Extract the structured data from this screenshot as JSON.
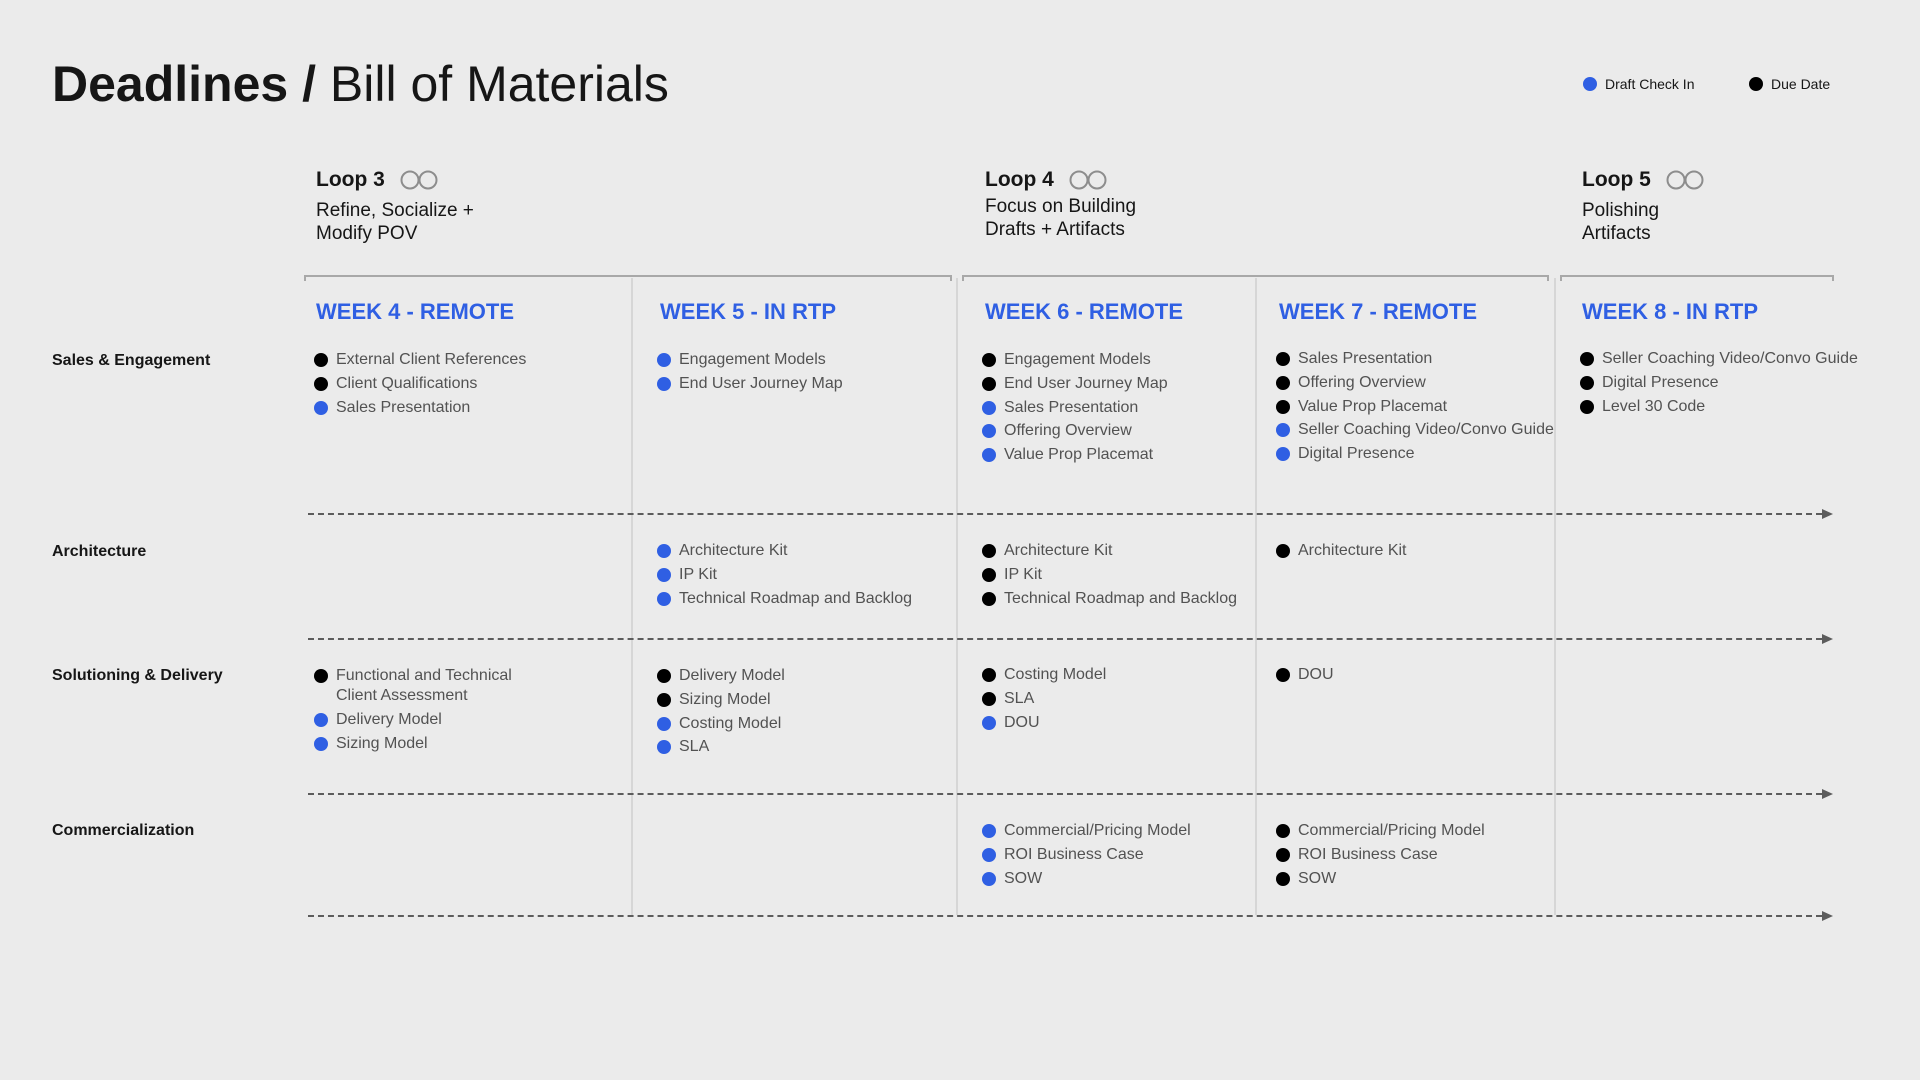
{
  "title": {
    "bold": "Deadlines /",
    "light": "Bill of Materials"
  },
  "colors": {
    "draft": "#2f5fe3",
    "due": "#000000",
    "week": "#2f5fe3"
  },
  "legend": {
    "draft": "Draft Check In",
    "due": "Due Date"
  },
  "loops": [
    {
      "name": "Loop 3",
      "subtitle": "Refine, Socialize +\nModify POV",
      "icon": "infinity-icon"
    },
    {
      "name": "Loop 4",
      "subtitle": "Focus on Building\nDrafts + Artifacts",
      "icon": "infinity-icon"
    },
    {
      "name": "Loop 5",
      "subtitle": "Polishing\nArtifacts",
      "icon": "infinity-icon"
    }
  ],
  "weeks": [
    "WEEK 4 - REMOTE",
    "WEEK 5 - IN RTP",
    "WEEK 6 - REMOTE",
    "WEEK 7 - REMOTE",
    "WEEK 8 - IN RTP"
  ],
  "rows": [
    "Sales & Engagement",
    "Architecture",
    "Solutioning & Delivery",
    "Commercialization"
  ],
  "cells": {
    "sales": [
      [
        {
          "t": "External Client References",
          "k": "due"
        },
        {
          "t": "Client Qualifications",
          "k": "due"
        },
        {
          "t": "Sales Presentation",
          "k": "draft"
        }
      ],
      [
        {
          "t": "Engagement Models",
          "k": "draft"
        },
        {
          "t": "End User Journey Map",
          "k": "draft"
        }
      ],
      [
        {
          "t": "Engagement Models",
          "k": "due"
        },
        {
          "t": "End User Journey Map",
          "k": "due"
        },
        {
          "t": "Sales Presentation",
          "k": "draft"
        },
        {
          "t": "Offering Overview",
          "k": "draft"
        },
        {
          "t": "Value Prop Placemat",
          "k": "draft"
        }
      ],
      [
        {
          "t": "Sales Presentation",
          "k": "due"
        },
        {
          "t": "Offering Overview",
          "k": "due"
        },
        {
          "t": "Value Prop Placemat",
          "k": "due"
        },
        {
          "t": "Seller Coaching Video/Convo Guide",
          "k": "draft"
        },
        {
          "t": "Digital Presence",
          "k": "draft"
        }
      ],
      [
        {
          "t": "Seller Coaching Video/Convo Guide",
          "k": "due"
        },
        {
          "t": "Digital Presence",
          "k": "due"
        },
        {
          "t": "Level 30 Code",
          "k": "due"
        }
      ]
    ],
    "architecture": [
      [],
      [
        {
          "t": "Architecture Kit",
          "k": "draft"
        },
        {
          "t": "IP Kit",
          "k": "draft"
        },
        {
          "t": "Technical Roadmap and Backlog",
          "k": "draft"
        }
      ],
      [
        {
          "t": "Architecture Kit",
          "k": "due"
        },
        {
          "t": "IP Kit",
          "k": "due"
        },
        {
          "t": "Technical Roadmap and Backlog",
          "k": "due"
        }
      ],
      [
        {
          "t": "Architecture Kit",
          "k": "due"
        }
      ],
      []
    ],
    "solutioning": [
      [
        {
          "t": "Functional and Technical\nClient Assessment",
          "k": "due"
        },
        {
          "t": "Delivery Model",
          "k": "draft"
        },
        {
          "t": "Sizing Model",
          "k": "draft"
        }
      ],
      [
        {
          "t": "Delivery Model",
          "k": "due"
        },
        {
          "t": "Sizing Model",
          "k": "due"
        },
        {
          "t": "Costing Model",
          "k": "draft"
        },
        {
          "t": "SLA",
          "k": "draft"
        }
      ],
      [
        {
          "t": "Costing Model",
          "k": "due"
        },
        {
          "t": "SLA",
          "k": "due"
        },
        {
          "t": "DOU",
          "k": "draft"
        }
      ],
      [
        {
          "t": "DOU",
          "k": "due"
        }
      ],
      []
    ],
    "commercialization": [
      [],
      [],
      [
        {
          "t": "Commercial/Pricing Model",
          "k": "draft"
        },
        {
          "t": "ROI Business Case",
          "k": "draft"
        },
        {
          "t": "SOW",
          "k": "draft"
        }
      ],
      [
        {
          "t": "Commercial/Pricing Model",
          "k": "due"
        },
        {
          "t": "ROI Business Case",
          "k": "due"
        },
        {
          "t": "SOW",
          "k": "due"
        }
      ],
      []
    ]
  }
}
